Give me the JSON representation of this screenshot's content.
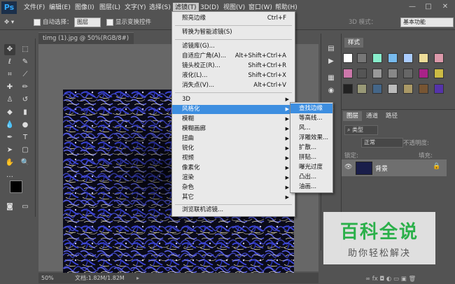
{
  "app": {
    "logo": "Ps"
  },
  "menubar": {
    "items": [
      "文件(F)",
      "编辑(E)",
      "图像(I)",
      "图层(L)",
      "文字(Y)",
      "选择(S)",
      "滤镜(T)",
      "3D(D)",
      "视图(V)",
      "窗口(W)",
      "帮助(H)"
    ],
    "active_index": 6
  },
  "window_controls": {
    "minimize": "—",
    "maximize": "□",
    "close": "✕"
  },
  "options_bar": {
    "auto_select_label": "自动选择：",
    "auto_select_value": "图层",
    "show_transform_label": "显示变换控件",
    "mode_3d_label": "3D 模式：",
    "workspace_value": "基本功能"
  },
  "document": {
    "tab_title": "timg (1).jpg @ 50%(RGB/8#) *",
    "tab_close": "×",
    "zoom": "50%",
    "doc_info": "文档:1.82M/1.82M"
  },
  "filter_menu": {
    "items": [
      {
        "label": "照亮边缘",
        "shortcut": "Ctrl+F",
        "submenu": false
      },
      {
        "label": "转换为智能滤镜(S)",
        "shortcut": "",
        "submenu": false
      },
      {
        "label": "滤镜库(G)...",
        "shortcut": "",
        "submenu": false
      },
      {
        "label": "自适应广角(A)...",
        "shortcut": "Alt+Shift+Ctrl+A",
        "submenu": false
      },
      {
        "label": "镜头校正(R)...",
        "shortcut": "Shift+Ctrl+R",
        "submenu": false
      },
      {
        "label": "液化(L)...",
        "shortcut": "Shift+Ctrl+X",
        "submenu": false
      },
      {
        "label": "消失点(V)...",
        "shortcut": "Alt+Ctrl+V",
        "submenu": false
      },
      {
        "label": "3D",
        "shortcut": "",
        "submenu": true
      },
      {
        "label": "风格化",
        "shortcut": "",
        "submenu": true,
        "highlighted": true
      },
      {
        "label": "模糊",
        "shortcut": "",
        "submenu": true
      },
      {
        "label": "模糊画廊",
        "shortcut": "",
        "submenu": true
      },
      {
        "label": "扭曲",
        "shortcut": "",
        "submenu": true
      },
      {
        "label": "锐化",
        "shortcut": "",
        "submenu": true
      },
      {
        "label": "视频",
        "shortcut": "",
        "submenu": true
      },
      {
        "label": "像素化",
        "shortcut": "",
        "submenu": true
      },
      {
        "label": "渲染",
        "shortcut": "",
        "submenu": true
      },
      {
        "label": "杂色",
        "shortcut": "",
        "submenu": true
      },
      {
        "label": "其它",
        "shortcut": "",
        "submenu": true
      },
      {
        "label": "浏览联机滤镜...",
        "shortcut": "",
        "submenu": false
      }
    ]
  },
  "stylize_submenu": {
    "items": [
      "查找边缘",
      "等高线...",
      "风...",
      "浮雕效果...",
      "扩散...",
      "拼贴...",
      "曝光过度",
      "凸出...",
      "油画..."
    ],
    "highlighted_index": 0
  },
  "swatch_panel": {
    "tab": "样式"
  },
  "layers_panel": {
    "tabs": [
      "图层",
      "通道",
      "路径"
    ],
    "active_tab": 0,
    "filter_label": "类型",
    "blend_mode": "正常",
    "opacity_label": "不透明度:",
    "lock_label": "锁定:",
    "fill_label": "填充:",
    "layer_name": "背景",
    "bottom_icons": "∞ fx ◘ ◐ ▭ ▣ 🗑"
  },
  "watermark": {
    "title": "百科全说",
    "subtitle": "助你轻松解决"
  },
  "colors": {
    "highlight": "#3d8ee0",
    "panel": "#535353",
    "menu_bg": "#e9e9e9"
  }
}
